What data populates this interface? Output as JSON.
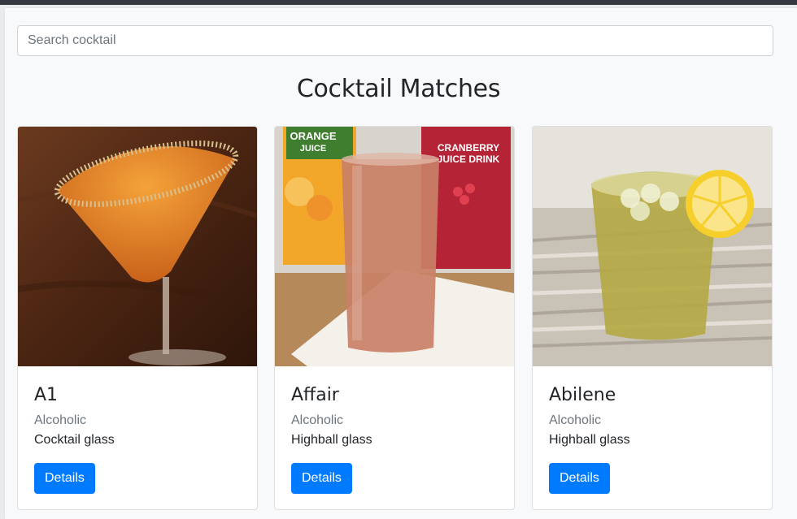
{
  "search": {
    "placeholder": "Search cocktail"
  },
  "page": {
    "title": "Cocktail Matches"
  },
  "colors": {
    "primary": "#007bff",
    "topbar": "#343a40",
    "background": "#f8f9fa"
  },
  "cards": [
    {
      "name": "A1",
      "category": "Alcoholic",
      "glass": "Cocktail glass",
      "button_label": "Details",
      "image": "orange-martini-photo"
    },
    {
      "name": "Affair",
      "category": "Alcoholic",
      "glass": "Highball glass",
      "button_label": "Details",
      "image": "highball-with-juice-cartons-photo",
      "image_text": {
        "carton_left_line1": "ORANGE",
        "carton_left_line2": "JUICE",
        "carton_right_line1": "CRANBERRY",
        "carton_right_line2": "JUICE DRINK"
      }
    },
    {
      "name": "Abilene",
      "category": "Alcoholic",
      "glass": "Highball glass",
      "button_label": "Details",
      "image": "iced-drink-with-lemon-photo"
    }
  ]
}
